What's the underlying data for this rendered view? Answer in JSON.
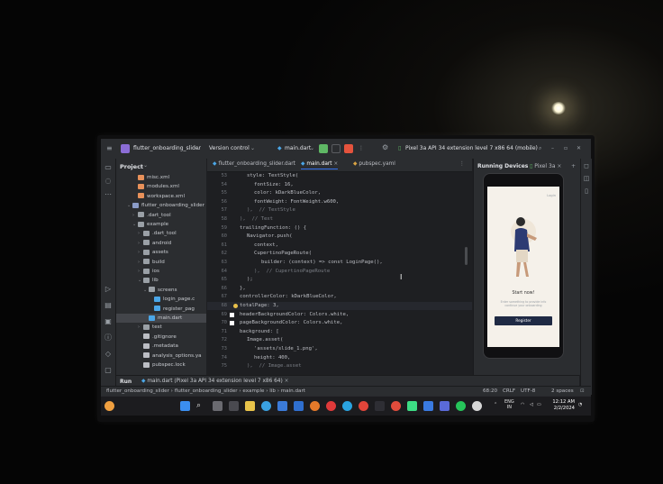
{
  "titlebar": {
    "project_name": "flutter_onboarding_slider",
    "vcs": "Version control",
    "run_config": "main.dart",
    "device": "Pixel 3a API 34 extension level 7 x86 64 (mobile)"
  },
  "project_panel": {
    "title": "Project",
    "tree": [
      {
        "label": "misc.xml",
        "icon": "xml-file-icon",
        "indent": 3,
        "arrow": ""
      },
      {
        "label": "modules.xml",
        "icon": "xml-file-icon",
        "indent": 3,
        "arrow": ""
      },
      {
        "label": "workspace.xml",
        "icon": "xml-file-icon",
        "indent": 3,
        "arrow": ""
      },
      {
        "label": "flutter_onboarding_slider",
        "icon": "module-icon",
        "indent": 2,
        "arrow": "v"
      },
      {
        "label": ".dart_tool",
        "icon": "folder-icon",
        "indent": 3,
        "arrow": ">"
      },
      {
        "label": "example",
        "icon": "folder-icon",
        "indent": 3,
        "arrow": "v"
      },
      {
        "label": ".dart_tool",
        "icon": "folder-icon",
        "indent": 4,
        "arrow": ">"
      },
      {
        "label": "android",
        "icon": "folder-icon",
        "indent": 4,
        "arrow": ">"
      },
      {
        "label": "assets",
        "icon": "folder-icon",
        "indent": 4,
        "arrow": ">"
      },
      {
        "label": "build",
        "icon": "folder-icon",
        "indent": 4,
        "arrow": ">"
      },
      {
        "label": "ios",
        "icon": "folder-icon",
        "indent": 4,
        "arrow": ">"
      },
      {
        "label": "lib",
        "icon": "folder-icon",
        "indent": 4,
        "arrow": "v"
      },
      {
        "label": "screens",
        "icon": "folder-icon",
        "indent": 5,
        "arrow": "v"
      },
      {
        "label": "login_page.c",
        "icon": "dart-file-icon",
        "indent": 6,
        "arrow": ""
      },
      {
        "label": "register_pag",
        "icon": "dart-file-icon",
        "indent": 6,
        "arrow": ""
      },
      {
        "label": "main.dart",
        "icon": "dart-file-icon",
        "indent": 5,
        "arrow": "",
        "selected": true
      },
      {
        "label": "test",
        "icon": "folder-icon",
        "indent": 4,
        "arrow": ">"
      },
      {
        "label": ".gitignore",
        "icon": "file-icon",
        "indent": 4,
        "arrow": ""
      },
      {
        "label": ".metadata",
        "icon": "file-icon",
        "indent": 4,
        "arrow": ""
      },
      {
        "label": "analysis_options.ya",
        "icon": "file-icon",
        "indent": 4,
        "arrow": ""
      },
      {
        "label": "pubspec.lock",
        "icon": "file-icon",
        "indent": 4,
        "arrow": ""
      }
    ]
  },
  "editor": {
    "tabs": [
      {
        "label": "flutter_onboarding_slider.dart"
      },
      {
        "label": "main.dart",
        "active": true
      },
      {
        "label": "pubspec.yaml"
      }
    ],
    "lines": [
      {
        "n": "53",
        "text": "style: TextStyle(",
        "indent": 4
      },
      {
        "n": "54",
        "text": "fontSize: 16,",
        "indent": 5
      },
      {
        "n": "55",
        "text": "color: kDarkBlueColor,",
        "indent": 5
      },
      {
        "n": "56",
        "text": "fontWeight: FontWeight.w600,",
        "indent": 5
      },
      {
        "n": "57",
        "text": "),  // TextStyle",
        "indent": 4,
        "comment": true
      },
      {
        "n": "58",
        "text": "),  // Text",
        "indent": 3,
        "comment": true
      },
      {
        "n": "59",
        "text": "trailingFunction: () {",
        "indent": 3
      },
      {
        "n": "60",
        "text": "Navigator.push(",
        "indent": 4
      },
      {
        "n": "61",
        "text": "context,",
        "indent": 5
      },
      {
        "n": "62",
        "text": "CupertinoPageRoute(",
        "indent": 5
      },
      {
        "n": "63",
        "text": "builder: (context) => const LoginPage(),",
        "indent": 6
      },
      {
        "n": "64",
        "text": "),  // CupertinoPageRoute",
        "indent": 5,
        "comment": true
      },
      {
        "n": "65",
        "text": ");",
        "indent": 4
      },
      {
        "n": "66",
        "text": "},",
        "indent": 3
      },
      {
        "n": "67",
        "text": "controllerColor: kDarkBlueColor,",
        "indent": 3
      },
      {
        "n": "68",
        "text": "totalPage: 3,",
        "indent": 3,
        "caret": true
      },
      {
        "n": "69",
        "text": "headerBackgroundColor: Colors.white,",
        "indent": 3
      },
      {
        "n": "70",
        "text": "pageBackgroundColor: Colors.white,",
        "indent": 3
      },
      {
        "n": "71",
        "text": "background: [",
        "indent": 3
      },
      {
        "n": "72",
        "text": "Image.asset(",
        "indent": 4
      },
      {
        "n": "73",
        "text": "'assets/slide_1.png',",
        "indent": 5
      },
      {
        "n": "74",
        "text": "height: 400,",
        "indent": 5
      },
      {
        "n": "75",
        "text": "),  // Image.asset",
        "indent": 4,
        "comment": true
      }
    ]
  },
  "devices_panel": {
    "title": "Running Devices",
    "tab": "Pixel 3a",
    "app": {
      "skip": "Login",
      "start_now": "Start now!",
      "description": "Enter something to provide info continue your onboarding",
      "register": "Register"
    }
  },
  "run_panel": {
    "label": "Run",
    "config": "main.dart (Pixel 3a API 34 extension level 7 x86 64)"
  },
  "statusbar": {
    "breadcrumbs": [
      "flutter_onboarding_slider",
      "flutter_onboarding_slider",
      "example",
      "lib",
      "main.dart"
    ],
    "position": "68:20",
    "line_sep": "CRLF",
    "encoding": "UTF-8",
    "indent": "2 spaces"
  },
  "taskbar": {
    "lang_line1": "ENG",
    "lang_line2": "IN",
    "time": "12:12 AM",
    "date": "2/2/2024"
  },
  "colors": {
    "ide_bg": "#1e1f22",
    "panel_bg": "#2b2d30",
    "accent": "#3574f0",
    "run_green": "#5fb865",
    "stop_red": "#e5533d"
  }
}
